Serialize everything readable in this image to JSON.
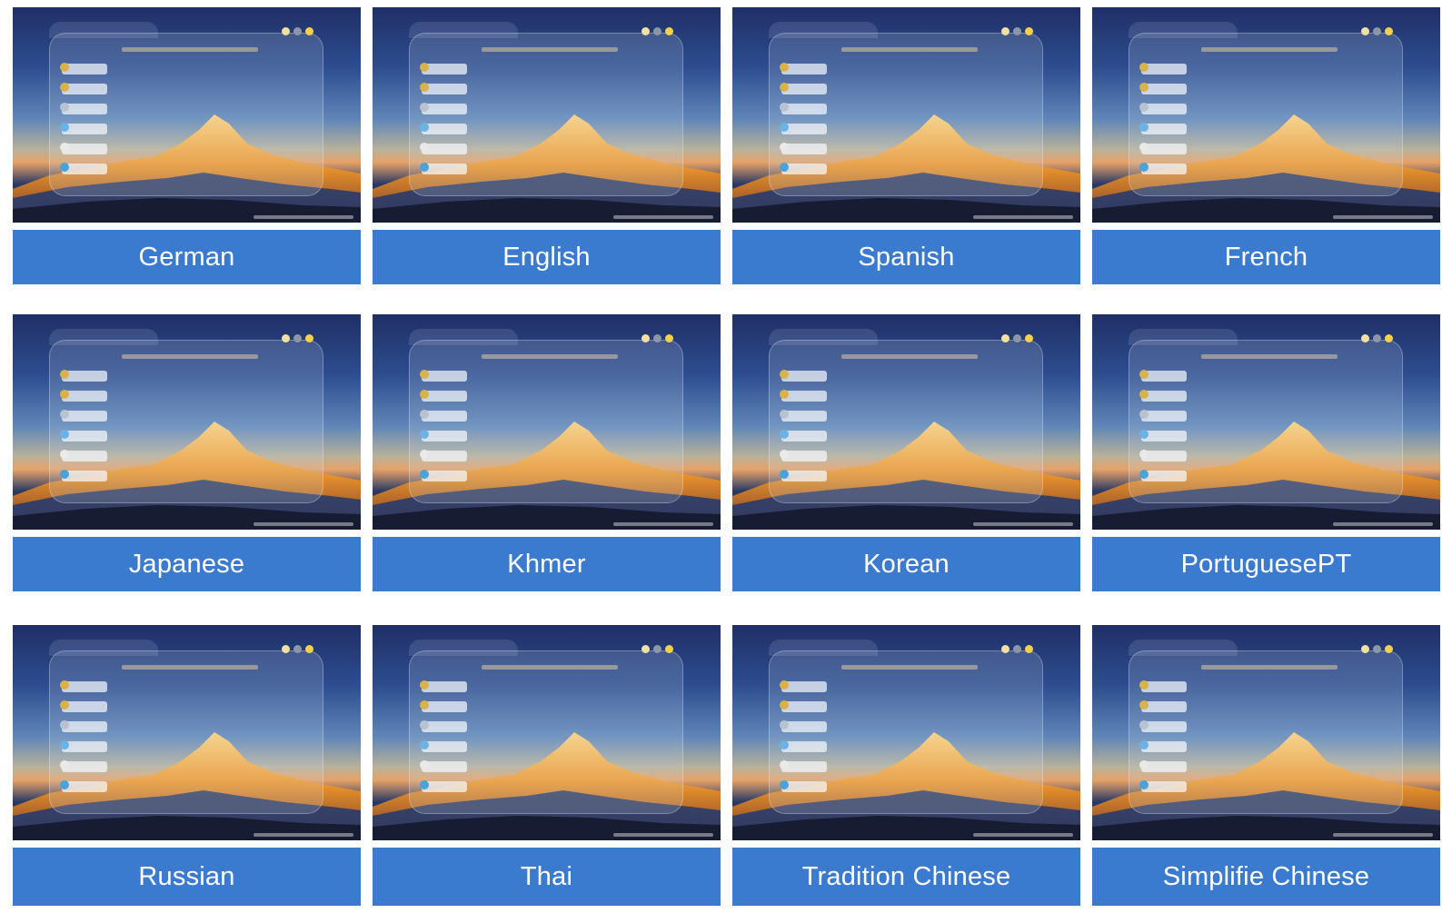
{
  "languages": [
    {
      "name": "German"
    },
    {
      "name": "English"
    },
    {
      "name": "Spanish"
    },
    {
      "name": "French"
    },
    {
      "name": "Japanese"
    },
    {
      "name": "Khmer"
    },
    {
      "name": "Korean"
    },
    {
      "name": "PortuguesePT"
    },
    {
      "name": "Russian"
    },
    {
      "name": "Thai"
    },
    {
      "name": "Tradition Chinese"
    },
    {
      "name": "Simplifie Chinese"
    }
  ],
  "colors": {
    "label_background": "#3b7bcf",
    "label_text": "#ffffff",
    "page_background": "#ffffff"
  }
}
